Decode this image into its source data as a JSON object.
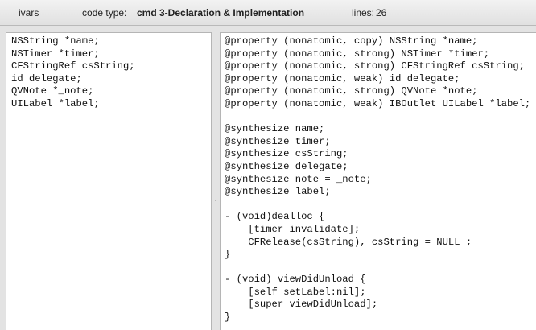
{
  "header": {
    "title": "ivars",
    "code_type_label": "code type:",
    "code_type_value": "cmd 3-Declaration & Implementation",
    "lines_label": "lines:",
    "lines_value": "26"
  },
  "left_pane": {
    "lines": [
      "NSString *name;",
      "NSTimer *timer;",
      "CFStringRef csString;",
      "id delegate;",
      "QVNote *_note;",
      "UILabel *label;"
    ]
  },
  "right_pane": {
    "lines": [
      "@property (nonatomic, copy) NSString *name;",
      "@property (nonatomic, strong) NSTimer *timer;",
      "@property (nonatomic, strong) CFStringRef csString;",
      "@property (nonatomic, weak) id delegate;",
      "@property (nonatomic, strong) QVNote *note;",
      "@property (nonatomic, weak) IBOutlet UILabel *label;",
      "",
      "@synthesize name;",
      "@synthesize timer;",
      "@synthesize csString;",
      "@synthesize delegate;",
      "@synthesize note = _note;",
      "@synthesize label;",
      "",
      "- (void)dealloc {",
      "    [timer invalidate];",
      "    CFRelease(csString), csString = NULL ;",
      "}",
      "",
      "- (void) viewDidUnload {",
      "    [self setLabel:nil];",
      "    [super viewDidUnload];",
      "}"
    ]
  },
  "splitter": {
    "grip_icon": "splitter-grip-icon",
    "grip_glyph": "‹"
  }
}
